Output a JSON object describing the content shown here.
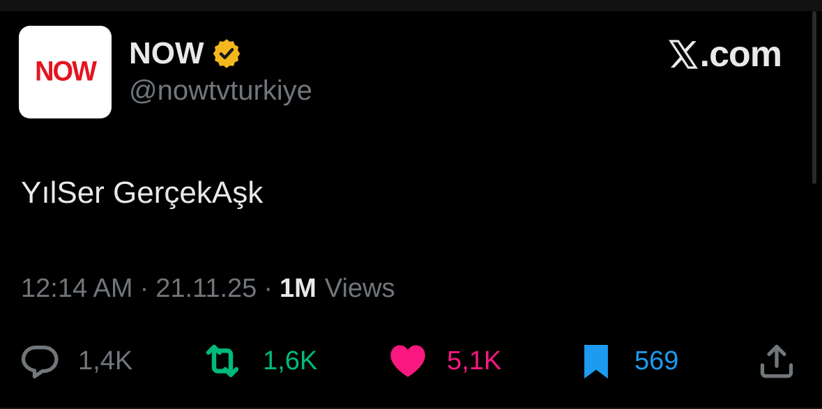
{
  "account": {
    "display_name": "NOW",
    "handle": "@nowtvturkiye",
    "avatar_logo_text": "NOW",
    "verified": true,
    "verified_color": "#F4B81E",
    "avatar_logo_color": "#E4141F"
  },
  "brand": {
    "label": ".com",
    "icon": "x-logo-icon"
  },
  "tweet": {
    "text": "YılSer GerçekAşk"
  },
  "meta": {
    "time": "12:14 AM",
    "separator": "·",
    "date": "21.11.25",
    "views_count": "1M",
    "views_label": "Views"
  },
  "actions": {
    "reply": {
      "icon": "reply-icon",
      "count": "1,4K",
      "color": "#71767B"
    },
    "retweet": {
      "icon": "retweet-icon",
      "count": "1,6K",
      "color": "#00BA7C"
    },
    "like": {
      "icon": "heart-icon",
      "count": "5,1K",
      "color": "#F91880"
    },
    "bookmark": {
      "icon": "bookmark-icon",
      "count": "569",
      "color": "#1D9BF0"
    },
    "share": {
      "icon": "share-icon"
    }
  }
}
